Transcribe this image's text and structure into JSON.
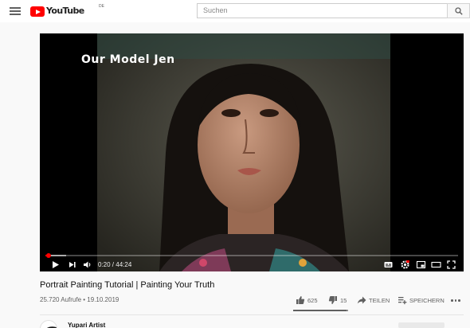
{
  "header": {
    "logo_text": "YouTube",
    "logo_country": "DE",
    "search_placeholder": "Suchen",
    "icons": {
      "menu": "hamburger-menu-icon",
      "search": "search-icon"
    }
  },
  "player": {
    "overlay_text": "Our Model Jen",
    "current_time": "0:20",
    "duration": "44:24",
    "time_separator": " / ",
    "played_fraction": 0.0075,
    "buffered_fraction": 0.05,
    "accent_color": "#ff0000",
    "controls": [
      "play-icon",
      "next-icon",
      "volume-icon",
      "subtitles-icon",
      "settings-icon",
      "miniplayer-icon",
      "theater-mode-icon",
      "fullscreen-icon"
    ]
  },
  "video": {
    "title": "Portrait Painting Tutorial | Painting Your Truth",
    "views": "25.720 Aufrufe",
    "bullet": " • ",
    "date": "19.10.2019",
    "likes": "625",
    "dislikes": "15",
    "like_fraction": 0.9766,
    "share_label": "TEILEN",
    "save_label": "SPEICHERN",
    "icons": {
      "like": "thumbs-up-icon",
      "dislike": "thumbs-down-icon",
      "share": "share-arrow-icon",
      "save": "add-to-playlist-icon",
      "more": "more-options-icon"
    }
  },
  "channel": {
    "name": "Yupari Artist",
    "icons": {
      "expand": "chevron-up-icon"
    }
  }
}
